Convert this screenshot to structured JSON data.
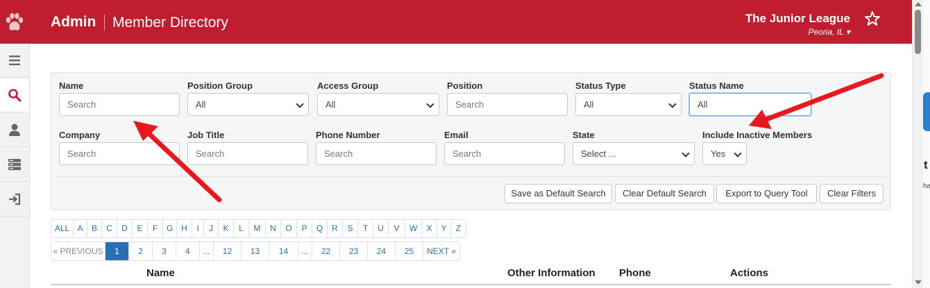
{
  "header": {
    "app_title": "Admin",
    "page_title": "Member Directory",
    "org_name": "The Junior League",
    "org_location": "Peoria, IL ▾",
    "brand_color": "#c01d2e"
  },
  "sidebar": {
    "items": [
      {
        "icon": "menu-icon"
      },
      {
        "icon": "search-icon",
        "active": true
      },
      {
        "icon": "user-icon"
      },
      {
        "icon": "server-icon"
      },
      {
        "icon": "sign-in-icon"
      }
    ]
  },
  "filters": {
    "name": {
      "label": "Name",
      "placeholder": "Search"
    },
    "position_group": {
      "label": "Position Group",
      "value": "All"
    },
    "access_group": {
      "label": "Access Group",
      "value": "All"
    },
    "position": {
      "label": "Position",
      "placeholder": "Search"
    },
    "status_type": {
      "label": "Status Type",
      "value": "All"
    },
    "status_name": {
      "label": "Status Name",
      "value": "All"
    },
    "company": {
      "label": "Company",
      "placeholder": "Search"
    },
    "job_title": {
      "label": "Job Title",
      "placeholder": "Search"
    },
    "phone_number": {
      "label": "Phone Number",
      "placeholder": "Search"
    },
    "email": {
      "label": "Email",
      "placeholder": "Search"
    },
    "state": {
      "label": "State",
      "value": "Select ..."
    },
    "include_inactive": {
      "label": "Include Inactive Members",
      "value": "Yes"
    }
  },
  "actions": {
    "save_default": "Save as Default Search",
    "clear_default": "Clear Default Search",
    "export": "Export to Query Tool",
    "clear_filters": "Clear Filters"
  },
  "alphabet": [
    "ALL",
    "A",
    "B",
    "C",
    "D",
    "E",
    "F",
    "G",
    "H",
    "I",
    "J",
    "K",
    "L",
    "M",
    "N",
    "O",
    "P",
    "Q",
    "R",
    "S",
    "T",
    "U",
    "V",
    "W",
    "X",
    "Y",
    "Z"
  ],
  "pagination": {
    "prev": "« PREVIOUS",
    "next": "NEXT »",
    "pages": [
      "1",
      "2",
      "3",
      "4",
      "...",
      "12",
      "13",
      "14",
      "...",
      "22",
      "23",
      "24",
      "25"
    ],
    "current": "1"
  },
  "table": {
    "columns": [
      "Name",
      "Other Information",
      "Phone",
      "Actions"
    ]
  },
  "annotation_color": "#e8191e"
}
